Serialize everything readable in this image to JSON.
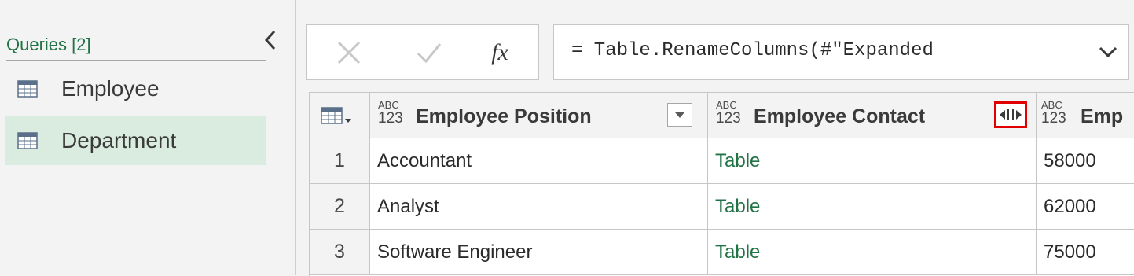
{
  "queries": {
    "title": "Queries [2]",
    "items": [
      {
        "label": "Employee",
        "icon": "table-icon",
        "selected": false
      },
      {
        "label": "Department",
        "icon": "table-icon",
        "selected": true
      }
    ]
  },
  "formula_bar": {
    "cancel_icon": "x-icon",
    "commit_icon": "check-icon",
    "fx_label": "fx",
    "formula": "= Table.RenameColumns(#\"Expanded"
  },
  "grid": {
    "columns": [
      {
        "type_top": "ABC",
        "type_bottom": "123",
        "name": "Employee Position",
        "control": "filter-dropdown"
      },
      {
        "type_top": "ABC",
        "type_bottom": "123",
        "name": "Employee Contact",
        "control": "expand-column"
      },
      {
        "type_top": "ABC",
        "type_bottom": "123",
        "name": "Emp",
        "control": ""
      }
    ],
    "rows": [
      {
        "num": "1",
        "position": "Accountant",
        "contact": "Table",
        "salary": "58000"
      },
      {
        "num": "2",
        "position": "Analyst",
        "contact": "Table",
        "salary": "62000"
      },
      {
        "num": "3",
        "position": "Software Engineer",
        "contact": "Table",
        "salary": "75000"
      }
    ]
  },
  "colors": {
    "accent_green": "#217346",
    "selected_bg": "#d9ecdf",
    "highlight_red": "#e00000"
  }
}
